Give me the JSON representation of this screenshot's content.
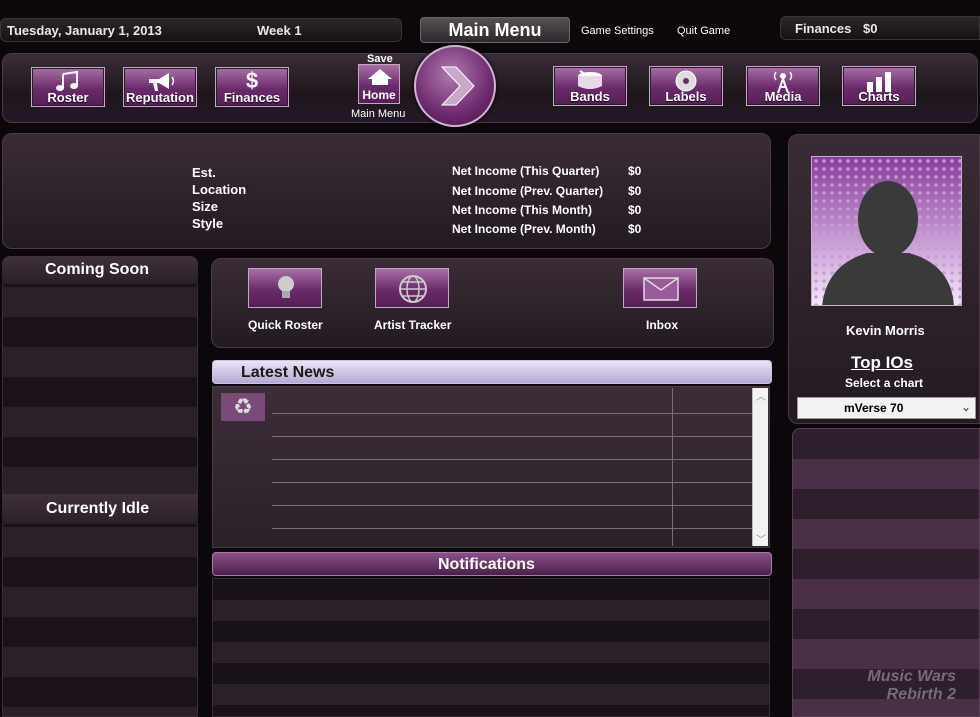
{
  "topbar": {
    "date": "Tuesday, January 1, 2013",
    "week": "Week 1",
    "main_menu": "Main Menu",
    "game_settings": "Game Settings",
    "quit_game": "Quit Game",
    "finances_label": "Finances",
    "finances_value": "$0"
  },
  "nav": {
    "roster": "Roster",
    "reputation": "Reputation",
    "finances": "Finances",
    "save": "Save",
    "home": "Home",
    "main_menu": "Main Menu",
    "bands": "Bands",
    "labels": "Labels",
    "media": "Media",
    "charts": "Charts"
  },
  "info": {
    "est": "Est.",
    "location": "Location",
    "size": "Size",
    "style": "Style",
    "income": [
      {
        "label": "Net Income (This Quarter)",
        "value": "$0"
      },
      {
        "label": "Net Income (Prev. Quarter)",
        "value": "$0"
      },
      {
        "label": "Net Income (This Month)",
        "value": "$0"
      },
      {
        "label": "Net Income (Prev. Month)",
        "value": "$0"
      }
    ]
  },
  "left": {
    "coming_soon": "Coming Soon",
    "currently_idle": "Currently Idle"
  },
  "actions": {
    "quick_roster": "Quick Roster",
    "artist_tracker": "Artist Tracker",
    "inbox": "Inbox"
  },
  "news": {
    "title": "Latest News"
  },
  "notifications": {
    "title": "Notifications"
  },
  "profile": {
    "name": "Kevin Morris",
    "top_ios": "Top IOs",
    "select_chart": "Select a chart",
    "chart_selected": "mVerse 70"
  },
  "logo": {
    "text": "Music Wars Rebirth 2"
  },
  "colors": {
    "accent": "#7a3a7a",
    "highlight": "#c9b6e6"
  }
}
